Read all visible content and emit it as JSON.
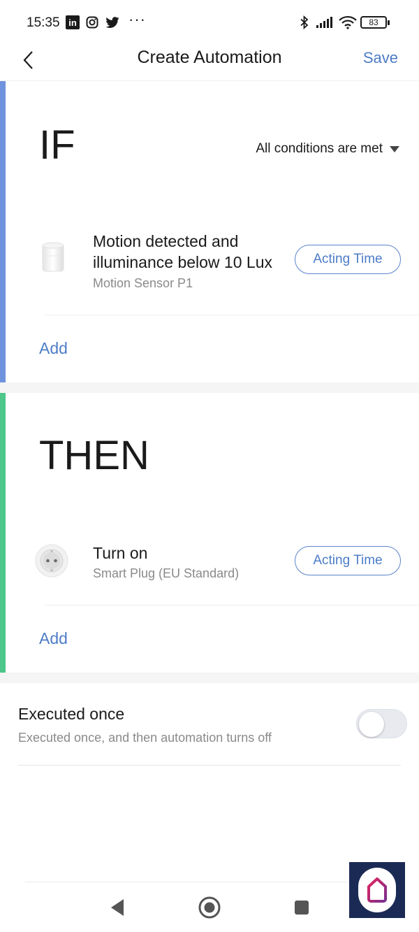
{
  "status_bar": {
    "time": "15:35",
    "battery": "83",
    "icons": [
      "linkedin-icon",
      "instagram-icon",
      "twitter-icon",
      "more-icon",
      "bluetooth-icon",
      "signal-icon",
      "wifi-icon",
      "battery-icon"
    ],
    "more": "···",
    "linkedin": "in"
  },
  "header": {
    "title": "Create Automation",
    "save_label": "Save",
    "back_icon": "chevron-left-icon"
  },
  "if_section": {
    "label": "IF",
    "accent_color": "#6f93de",
    "condition_mode": "All conditions are met",
    "items": [
      {
        "title_line1": "Motion detected and",
        "title_line2": "illuminance below 10 Lux",
        "device": "Motion Sensor P1",
        "icon": "motion-sensor-icon",
        "button": "Acting Time"
      }
    ],
    "add_label": "Add"
  },
  "then_section": {
    "label": "THEN",
    "accent_color": "#4dc78a",
    "items": [
      {
        "title": "Turn on",
        "device": "Smart Plug (EU Standard)",
        "icon": "smart-plug-icon",
        "button": "Acting Time"
      }
    ],
    "add_label": "Add"
  },
  "executed_once": {
    "title": "Executed once",
    "description": "Executed once, and then automation turns off",
    "enabled": false
  },
  "nav_bar": {
    "icons": [
      "back-triangle-icon",
      "home-circle-icon",
      "recents-square-icon"
    ]
  },
  "colors": {
    "link": "#4d7cc7",
    "if_accent": "#6f93de",
    "then_accent": "#4dc78a"
  }
}
